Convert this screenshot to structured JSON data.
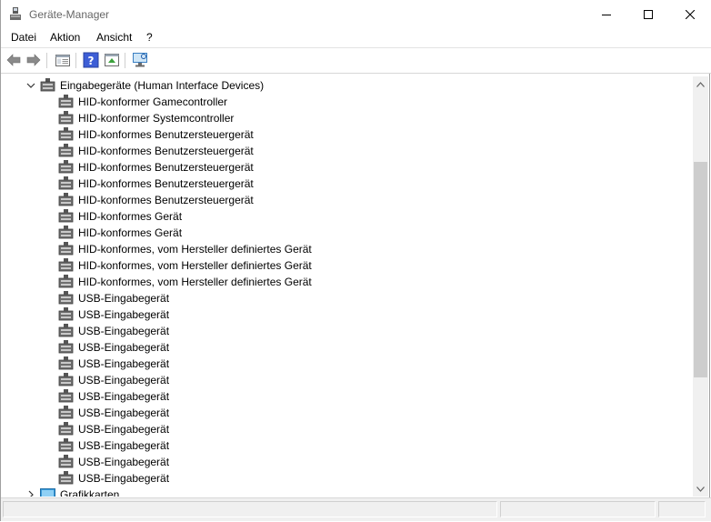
{
  "window": {
    "title": "Geräte-Manager"
  },
  "menu": [
    "Datei",
    "Aktion",
    "Ansicht",
    "?"
  ],
  "toolbar": [
    "back-icon",
    "forward-icon",
    "properties-icon",
    "help-icon",
    "update-driver-icon",
    "scan-hardware-icon"
  ],
  "tree": {
    "category": "Eingabegeräte (Human Interface Devices)",
    "devices": [
      "HID-konformer Gamecontroller",
      "HID-konformer Systemcontroller",
      "HID-konformes Benutzersteuergerät",
      "HID-konformes Benutzersteuergerät",
      "HID-konformes Benutzersteuergerät",
      "HID-konformes Benutzersteuergerät",
      "HID-konformes Benutzersteuergerät",
      "HID-konformes Gerät",
      "HID-konformes Gerät",
      "HID-konformes, vom Hersteller definiertes Gerät",
      "HID-konformes, vom Hersteller definiertes Gerät",
      "HID-konformes, vom Hersteller definiertes Gerät",
      "USB-Eingabegerät",
      "USB-Eingabegerät",
      "USB-Eingabegerät",
      "USB-Eingabegerät",
      "USB-Eingabegerät",
      "USB-Eingabegerät",
      "USB-Eingabegerät",
      "USB-Eingabegerät",
      "USB-Eingabegerät",
      "USB-Eingabegerät",
      "USB-Eingabegerät",
      "USB-Eingabegerät"
    ],
    "next_category": "Grafikkarten"
  },
  "icons": {
    "app": "device-manager-icon",
    "category": "hid-category-icon",
    "device": "hid-device-icon",
    "display": "display-adapter-icon"
  }
}
